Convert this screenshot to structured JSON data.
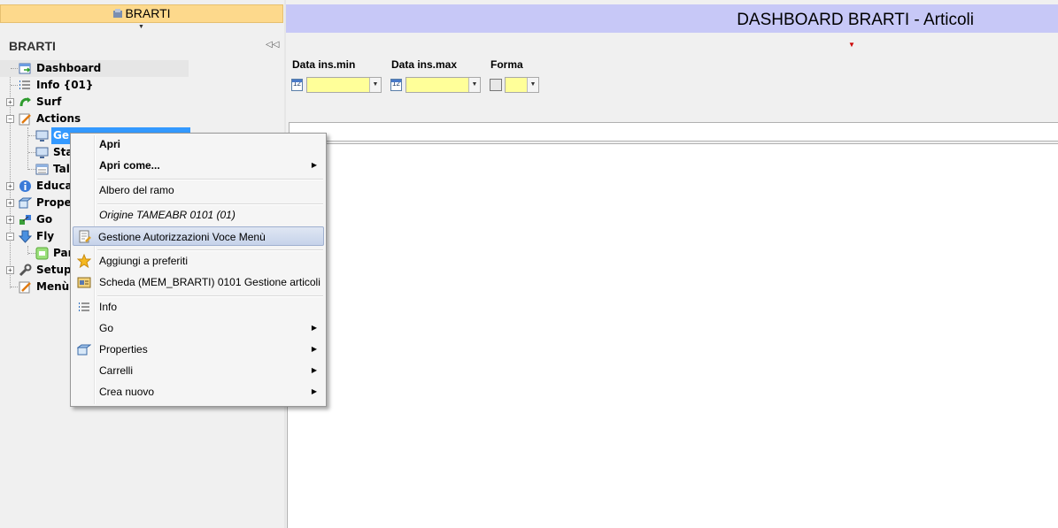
{
  "top_tab": {
    "label": "BRARTI"
  },
  "panel": {
    "title": "BRARTI"
  },
  "tree": [
    {
      "label": "Dashboard",
      "icon": "dashboard-icon",
      "expander": ""
    },
    {
      "label": "Info {01}",
      "icon": "list-icon",
      "expander": ""
    },
    {
      "label": "Surf",
      "icon": "surf-icon",
      "expander": "+"
    },
    {
      "label": "Actions",
      "icon": "actions-icon",
      "expander": "−"
    },
    {
      "label": "Ge",
      "icon": "monitor-icon",
      "expander": ""
    },
    {
      "label": "Sta",
      "icon": "monitor-icon",
      "expander": ""
    },
    {
      "label": "Tal",
      "icon": "table-icon",
      "expander": ""
    },
    {
      "label": "Educa",
      "icon": "info-icon",
      "expander": "+"
    },
    {
      "label": "Prope",
      "icon": "properties-icon",
      "expander": "+"
    },
    {
      "label": "Go",
      "icon": "go-icon",
      "expander": "+"
    },
    {
      "label": "Fly",
      "icon": "fly-icon",
      "expander": "−"
    },
    {
      "label": "Par",
      "icon": "panel-icon",
      "expander": ""
    },
    {
      "label": "Setup",
      "icon": "wrench-icon",
      "expander": "+"
    },
    {
      "label": "Menù",
      "icon": "menu-icon",
      "expander": ""
    }
  ],
  "header": {
    "title": "DASHBOARD BRARTI - Articoli"
  },
  "filters": {
    "date_min_label": "Data ins.min",
    "date_max_label": "Data ins.max",
    "forma_label": "Forma",
    "date_min_value": "",
    "date_max_value": "",
    "forma_value": "",
    "calendar_day": "12"
  },
  "context_menu": {
    "items": [
      {
        "label": "Apri",
        "submenu": false
      },
      {
        "label": "Apri come...",
        "submenu": true
      },
      {
        "label": "Albero del ramo",
        "submenu": false
      },
      {
        "label": "Origine TAMEABR 0101 (01)",
        "submenu": false
      },
      {
        "label": "Gestione Autorizzazioni Voce Menù",
        "submenu": false
      },
      {
        "label": "Aggiungi a preferiti",
        "submenu": false
      },
      {
        "label": "Scheda (MEM_BRARTI) 0101 Gestione articoli",
        "submenu": false
      },
      {
        "label": "Info",
        "submenu": false
      },
      {
        "label": "Go",
        "submenu": true
      },
      {
        "label": "Properties",
        "submenu": true
      },
      {
        "label": "Carrelli",
        "submenu": true
      },
      {
        "label": "Crea nuovo",
        "submenu": true
      }
    ],
    "submenu_arrow": "▶"
  },
  "colors": {
    "header_bg": "#c7c8f7",
    "tab_bg": "#fdd98c",
    "selection": "#3399ff",
    "combo_bg": "#ffff99"
  }
}
